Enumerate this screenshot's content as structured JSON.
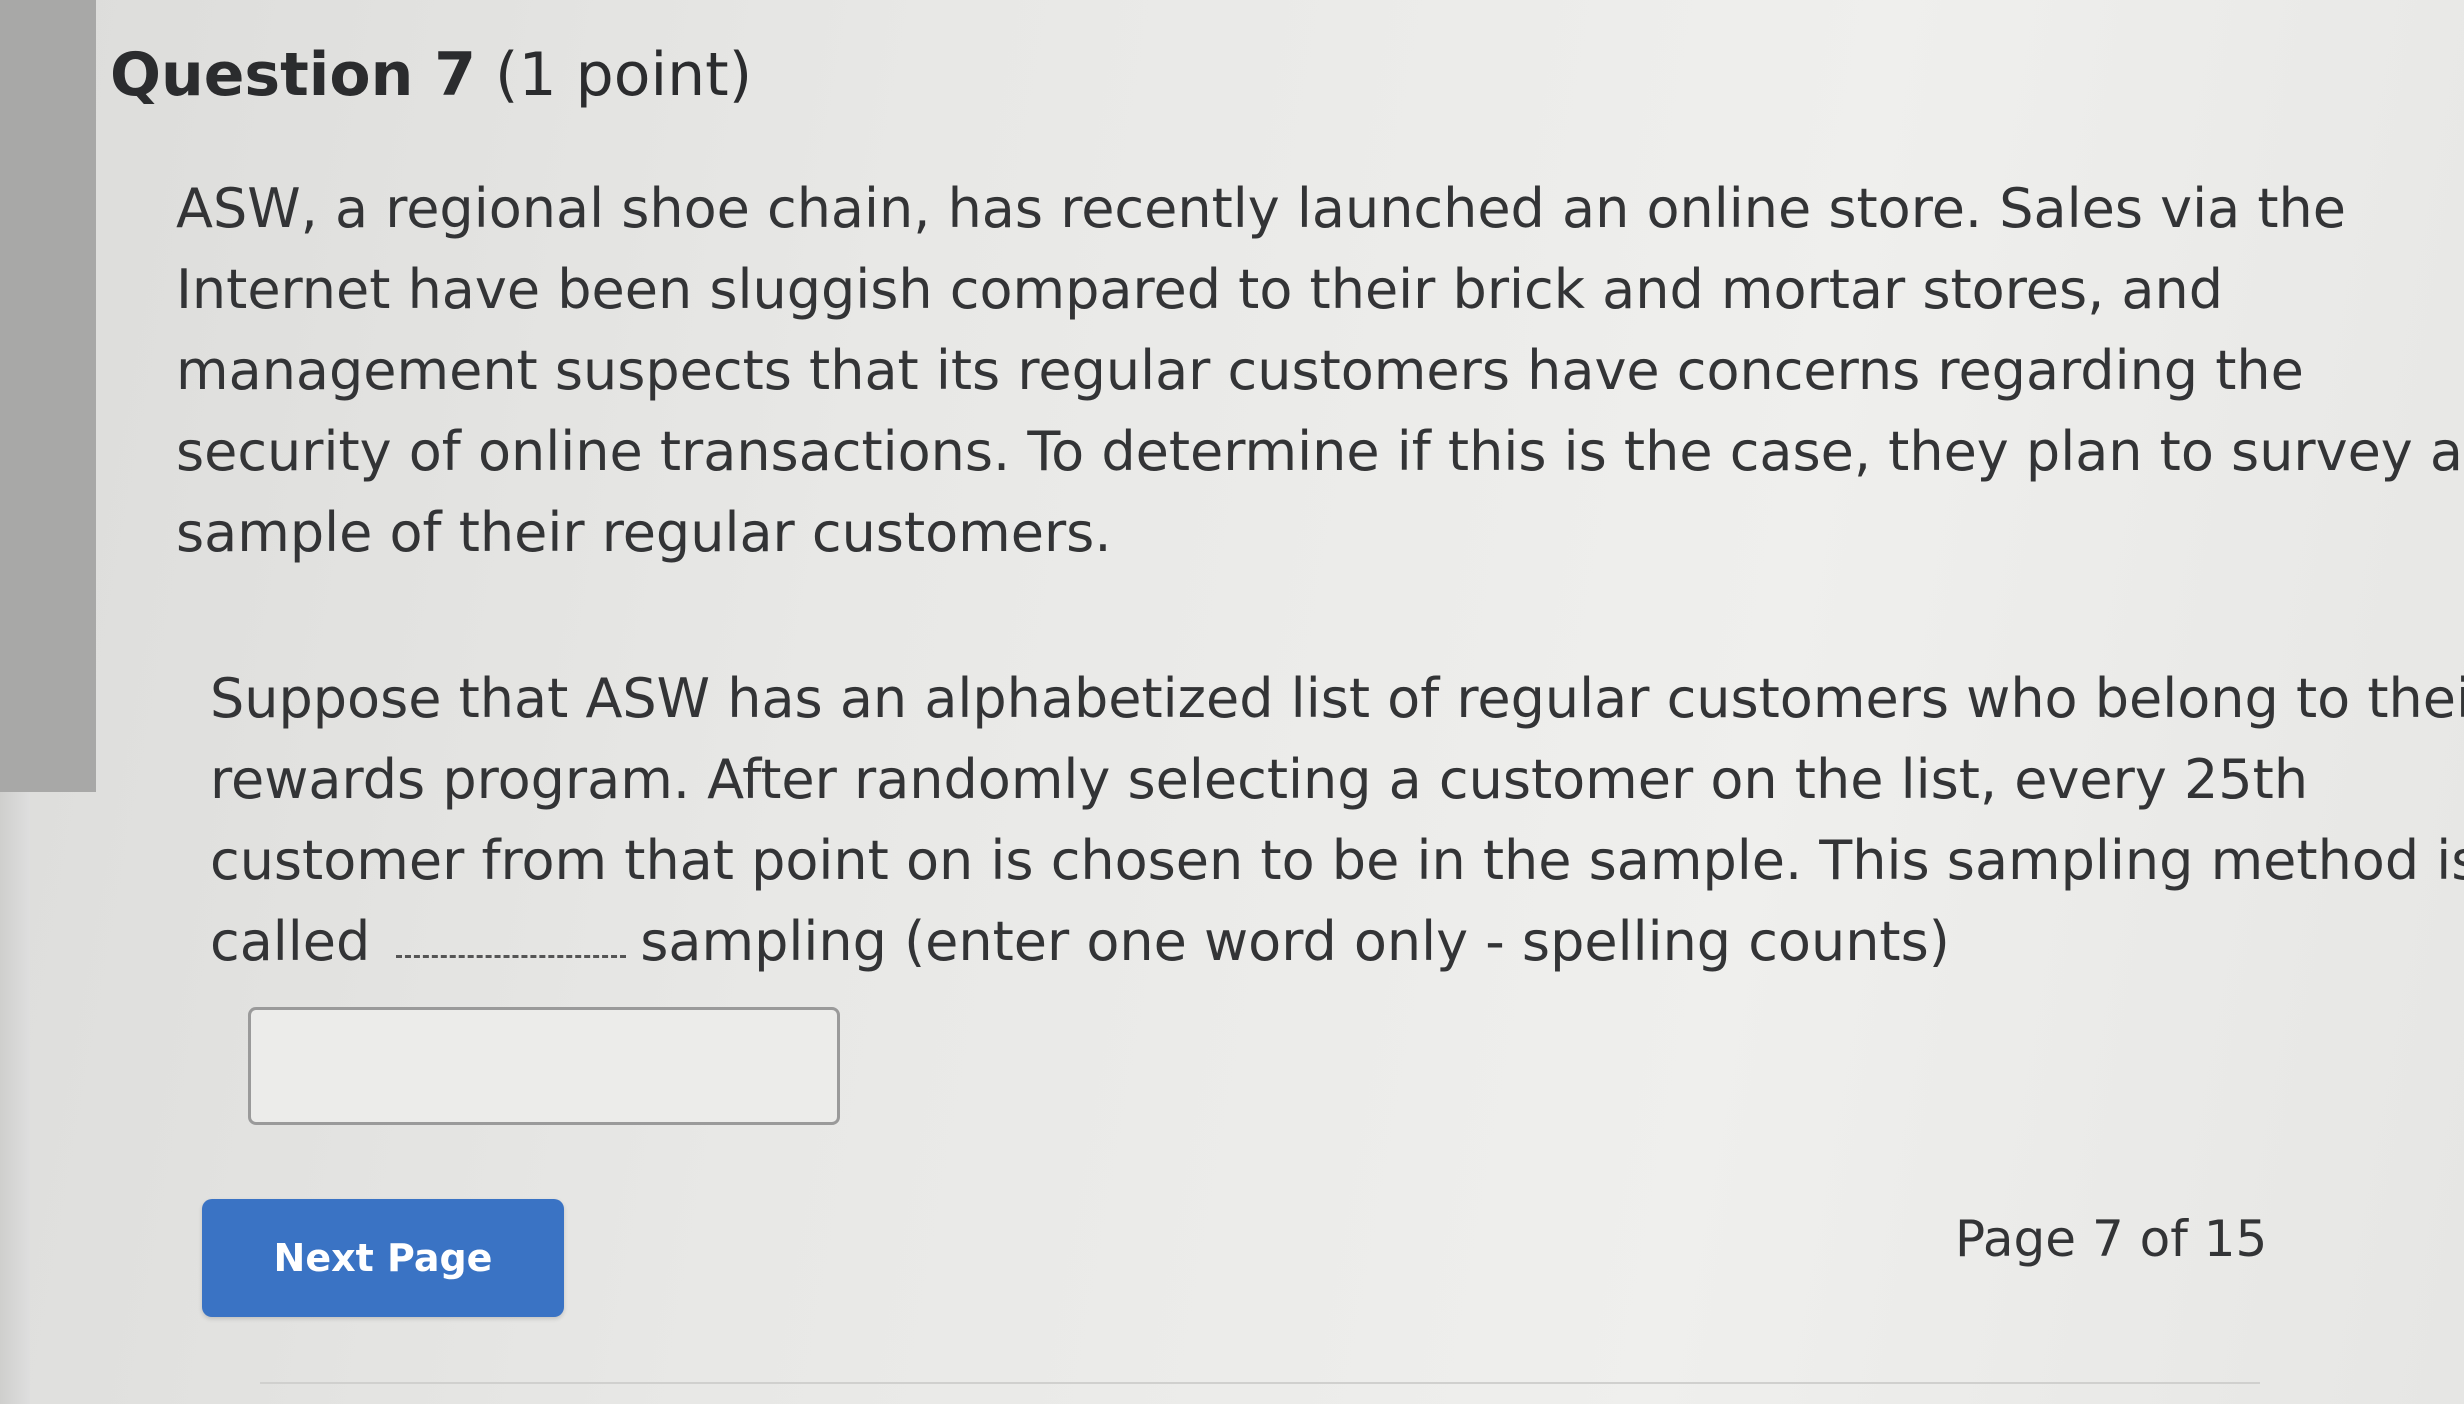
{
  "question": {
    "title": "Question 7",
    "points": "(1 point)"
  },
  "body": {
    "paragraph1_lines": [
      "ASW, a regional shoe chain, has recently launched an online store. Sales via the",
      "Internet have been sluggish compared to their brick and mortar stores, and",
      "management suspects that its regular customers have concerns regarding the",
      "security of online transactions. To determine if this is the case, they plan to survey a",
      "sample of their regular customers."
    ],
    "paragraph2_lines": [
      "Suppose that ASW has an alphabetized list of regular customers who belong to their",
      "rewards program. After randomly selecting a customer on the list, every 25th",
      "customer from that point on is chosen to be in the sample. This sampling method is"
    ],
    "paragraph2_last": {
      "before_blank": "called",
      "after_blank": "sampling (enter one word only - spelling counts)"
    }
  },
  "answer": {
    "value": "",
    "placeholder": ""
  },
  "navigation": {
    "next_label": "Next Page",
    "page_indicator": "Page 7 of 15"
  },
  "colors": {
    "accent": "#3a73c4",
    "text": "#333436",
    "background": "#e9e9e7"
  }
}
